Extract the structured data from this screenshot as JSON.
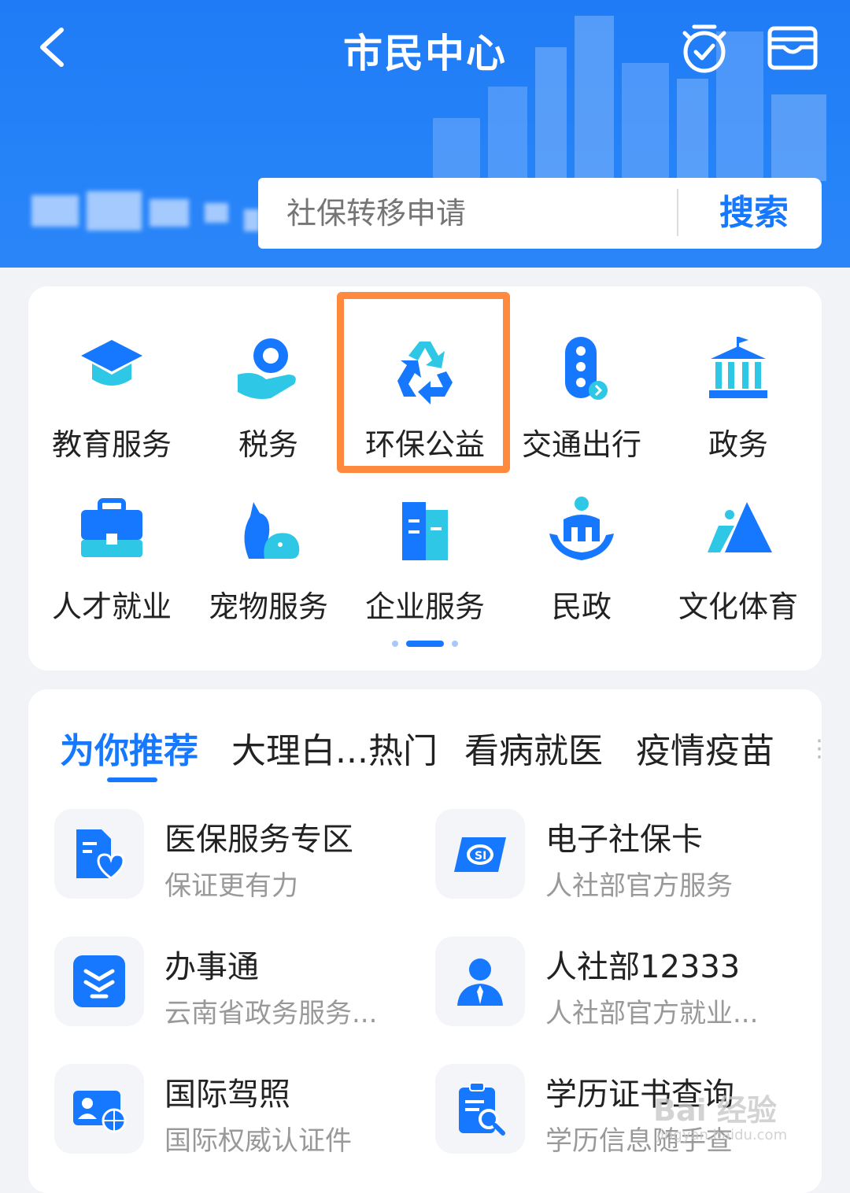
{
  "header": {
    "title": "市民中心",
    "colors": {
      "bg": "#1f7cf6",
      "accent": "#1677ff"
    }
  },
  "search": {
    "placeholder": "社保转移申请",
    "button_label": "搜索"
  },
  "categories": [
    {
      "label": "教育服务",
      "icon": "graduation-cap-icon"
    },
    {
      "label": "税务",
      "icon": "hand-coin-icon"
    },
    {
      "label": "环保公益",
      "icon": "recycle-icon",
      "highlighted": true
    },
    {
      "label": "交通出行",
      "icon": "traffic-light-icon"
    },
    {
      "label": "政务",
      "icon": "government-building-icon"
    },
    {
      "label": "人才就业",
      "icon": "briefcase-icon"
    },
    {
      "label": "宠物服务",
      "icon": "pets-icon"
    },
    {
      "label": "企业服务",
      "icon": "office-building-icon"
    },
    {
      "label": "民政",
      "icon": "people-care-icon"
    },
    {
      "label": "文化体育",
      "icon": "mountain-icon"
    }
  ],
  "pager": {
    "pages": 3,
    "active": 2
  },
  "recommend": {
    "tabs": [
      "为你推荐",
      "大理白...热门",
      "看病就医",
      "疫情疫苗"
    ],
    "active_tab": 0,
    "services": [
      {
        "title": "医保服务专区",
        "subtitle": "保证更有力",
        "icon": "medical-insurance-icon"
      },
      {
        "title": "电子社保卡",
        "subtitle": "人社部官方服务",
        "icon": "social-security-card-icon"
      },
      {
        "title": "办事通",
        "subtitle": "云南省政务服务...",
        "icon": "banshitong-icon"
      },
      {
        "title": "人社部12333",
        "subtitle": "人社部官方就业...",
        "icon": "person-icon"
      },
      {
        "title": "国际驾照",
        "subtitle": "国际权威认证件",
        "icon": "driver-license-icon"
      },
      {
        "title": "学历证书查询",
        "subtitle": "学历信息随手查",
        "icon": "certificate-search-icon"
      }
    ]
  },
  "watermark": {
    "brand": "Bai 经验",
    "url": "jingyan.baidu.com"
  }
}
